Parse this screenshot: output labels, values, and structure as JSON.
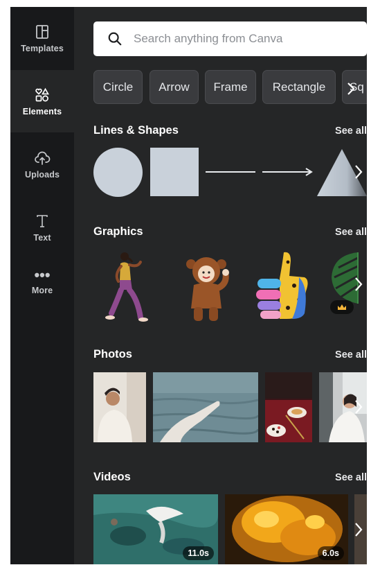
{
  "sidebar": {
    "items": [
      {
        "label": "Templates",
        "icon": "templates-icon"
      },
      {
        "label": "Elements",
        "icon": "elements-icon"
      },
      {
        "label": "Uploads",
        "icon": "upload-cloud-icon"
      },
      {
        "label": "Text",
        "icon": "text-icon"
      },
      {
        "label": "More",
        "icon": "more-icon"
      }
    ],
    "active": "Elements"
  },
  "search": {
    "placeholder": "Search anything from Canva"
  },
  "chips": [
    "Circle",
    "Arrow",
    "Frame",
    "Rectangle",
    "Sq"
  ],
  "sections": {
    "shapes": {
      "title": "Lines & Shapes",
      "see_all": "See all"
    },
    "graphics": {
      "title": "Graphics",
      "see_all": "See all"
    },
    "photos": {
      "title": "Photos",
      "see_all": "See all"
    },
    "videos": {
      "title": "Videos",
      "see_all": "See all"
    }
  },
  "videos": [
    {
      "duration": "11.0s"
    },
    {
      "duration": "6.0s"
    }
  ],
  "colors": {
    "panel_bg": "#252627",
    "sidebar_bg": "#18191b",
    "shape_fill": "#c9d1da",
    "chip_bg": "#3a3b3e"
  }
}
